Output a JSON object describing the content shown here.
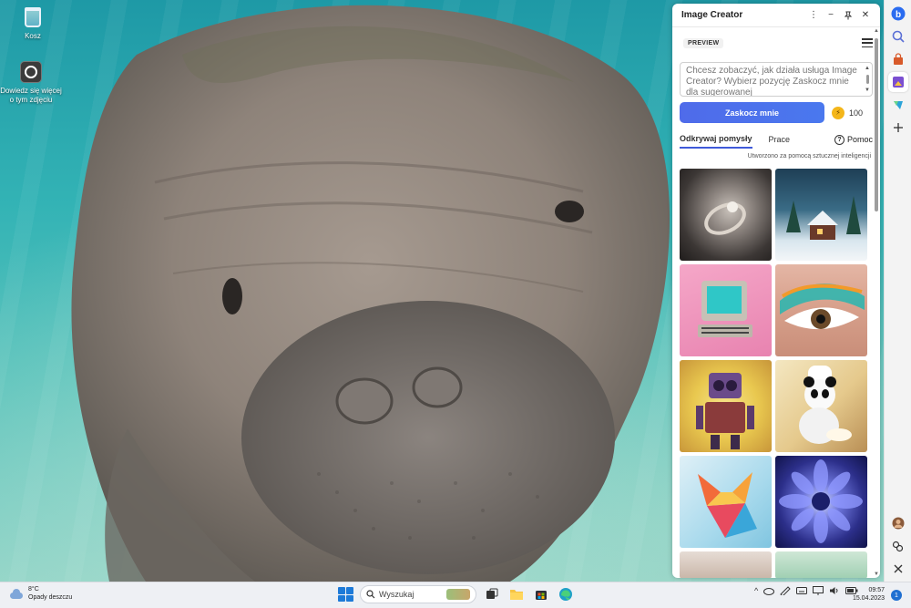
{
  "desktop": {
    "icons": [
      {
        "label": "Kosz"
      },
      {
        "label": "Dowiedz się więcej o tym zdjęciu"
      }
    ]
  },
  "panel": {
    "title": "Image Creator",
    "header_buttons": {
      "more": "⋮",
      "minimize": "−",
      "pin": "📌",
      "close": "✕"
    },
    "preview_badge": "PREVIEW",
    "prompt_placeholder": "Chcesz zobaczyć, jak działa usługa Image Creator? Wybierz pozycję Zaskocz mnie dla sugerowanej",
    "surprise_button": "Zaskocz mnie",
    "boost_count": "100",
    "tabs": [
      {
        "label": "Odkrywaj pomysły",
        "active": true
      },
      {
        "label": "Prace",
        "active": false
      }
    ],
    "help_label": "Pomoc",
    "ai_note": "Utworzono za pomocą sztucznej inteligencji",
    "gallery": [
      {
        "name": "ring-image",
        "style": "t-ring"
      },
      {
        "name": "winter-cabin-image",
        "style": "t-cabin"
      },
      {
        "name": "retro-computer-image",
        "style": "t-computer"
      },
      {
        "name": "eye-makeup-image",
        "style": "t-eye"
      },
      {
        "name": "robot-image",
        "style": "t-robot"
      },
      {
        "name": "panda-chef-image",
        "style": "t-panda"
      },
      {
        "name": "paper-fox-image",
        "style": "t-fox"
      },
      {
        "name": "blue-flower-image",
        "style": "t-flower"
      },
      {
        "name": "food-image",
        "style": "t-food"
      },
      {
        "name": "lily-pads-image",
        "style": "t-lily"
      }
    ]
  },
  "sidebar": {
    "items": [
      {
        "name": "bing-icon"
      },
      {
        "name": "search-icon"
      },
      {
        "name": "shopping-icon"
      },
      {
        "name": "image-creator-icon"
      },
      {
        "name": "drop-icon"
      },
      {
        "name": "add-icon"
      }
    ],
    "bottom": [
      {
        "name": "avatar-icon"
      },
      {
        "name": "settings-icon"
      },
      {
        "name": "close-sidebar-icon"
      }
    ]
  },
  "taskbar": {
    "temperature": "8°C",
    "weather": "Opady deszczu",
    "search_placeholder": "Wyszukaj",
    "time": "09:57",
    "date": "15.04.2023",
    "notifications": "1"
  },
  "colors": {
    "accent": "#4f6bea",
    "tab_underline": "#3f5ad9",
    "coin": "#f4b61a",
    "start": "#1d7ad8"
  }
}
